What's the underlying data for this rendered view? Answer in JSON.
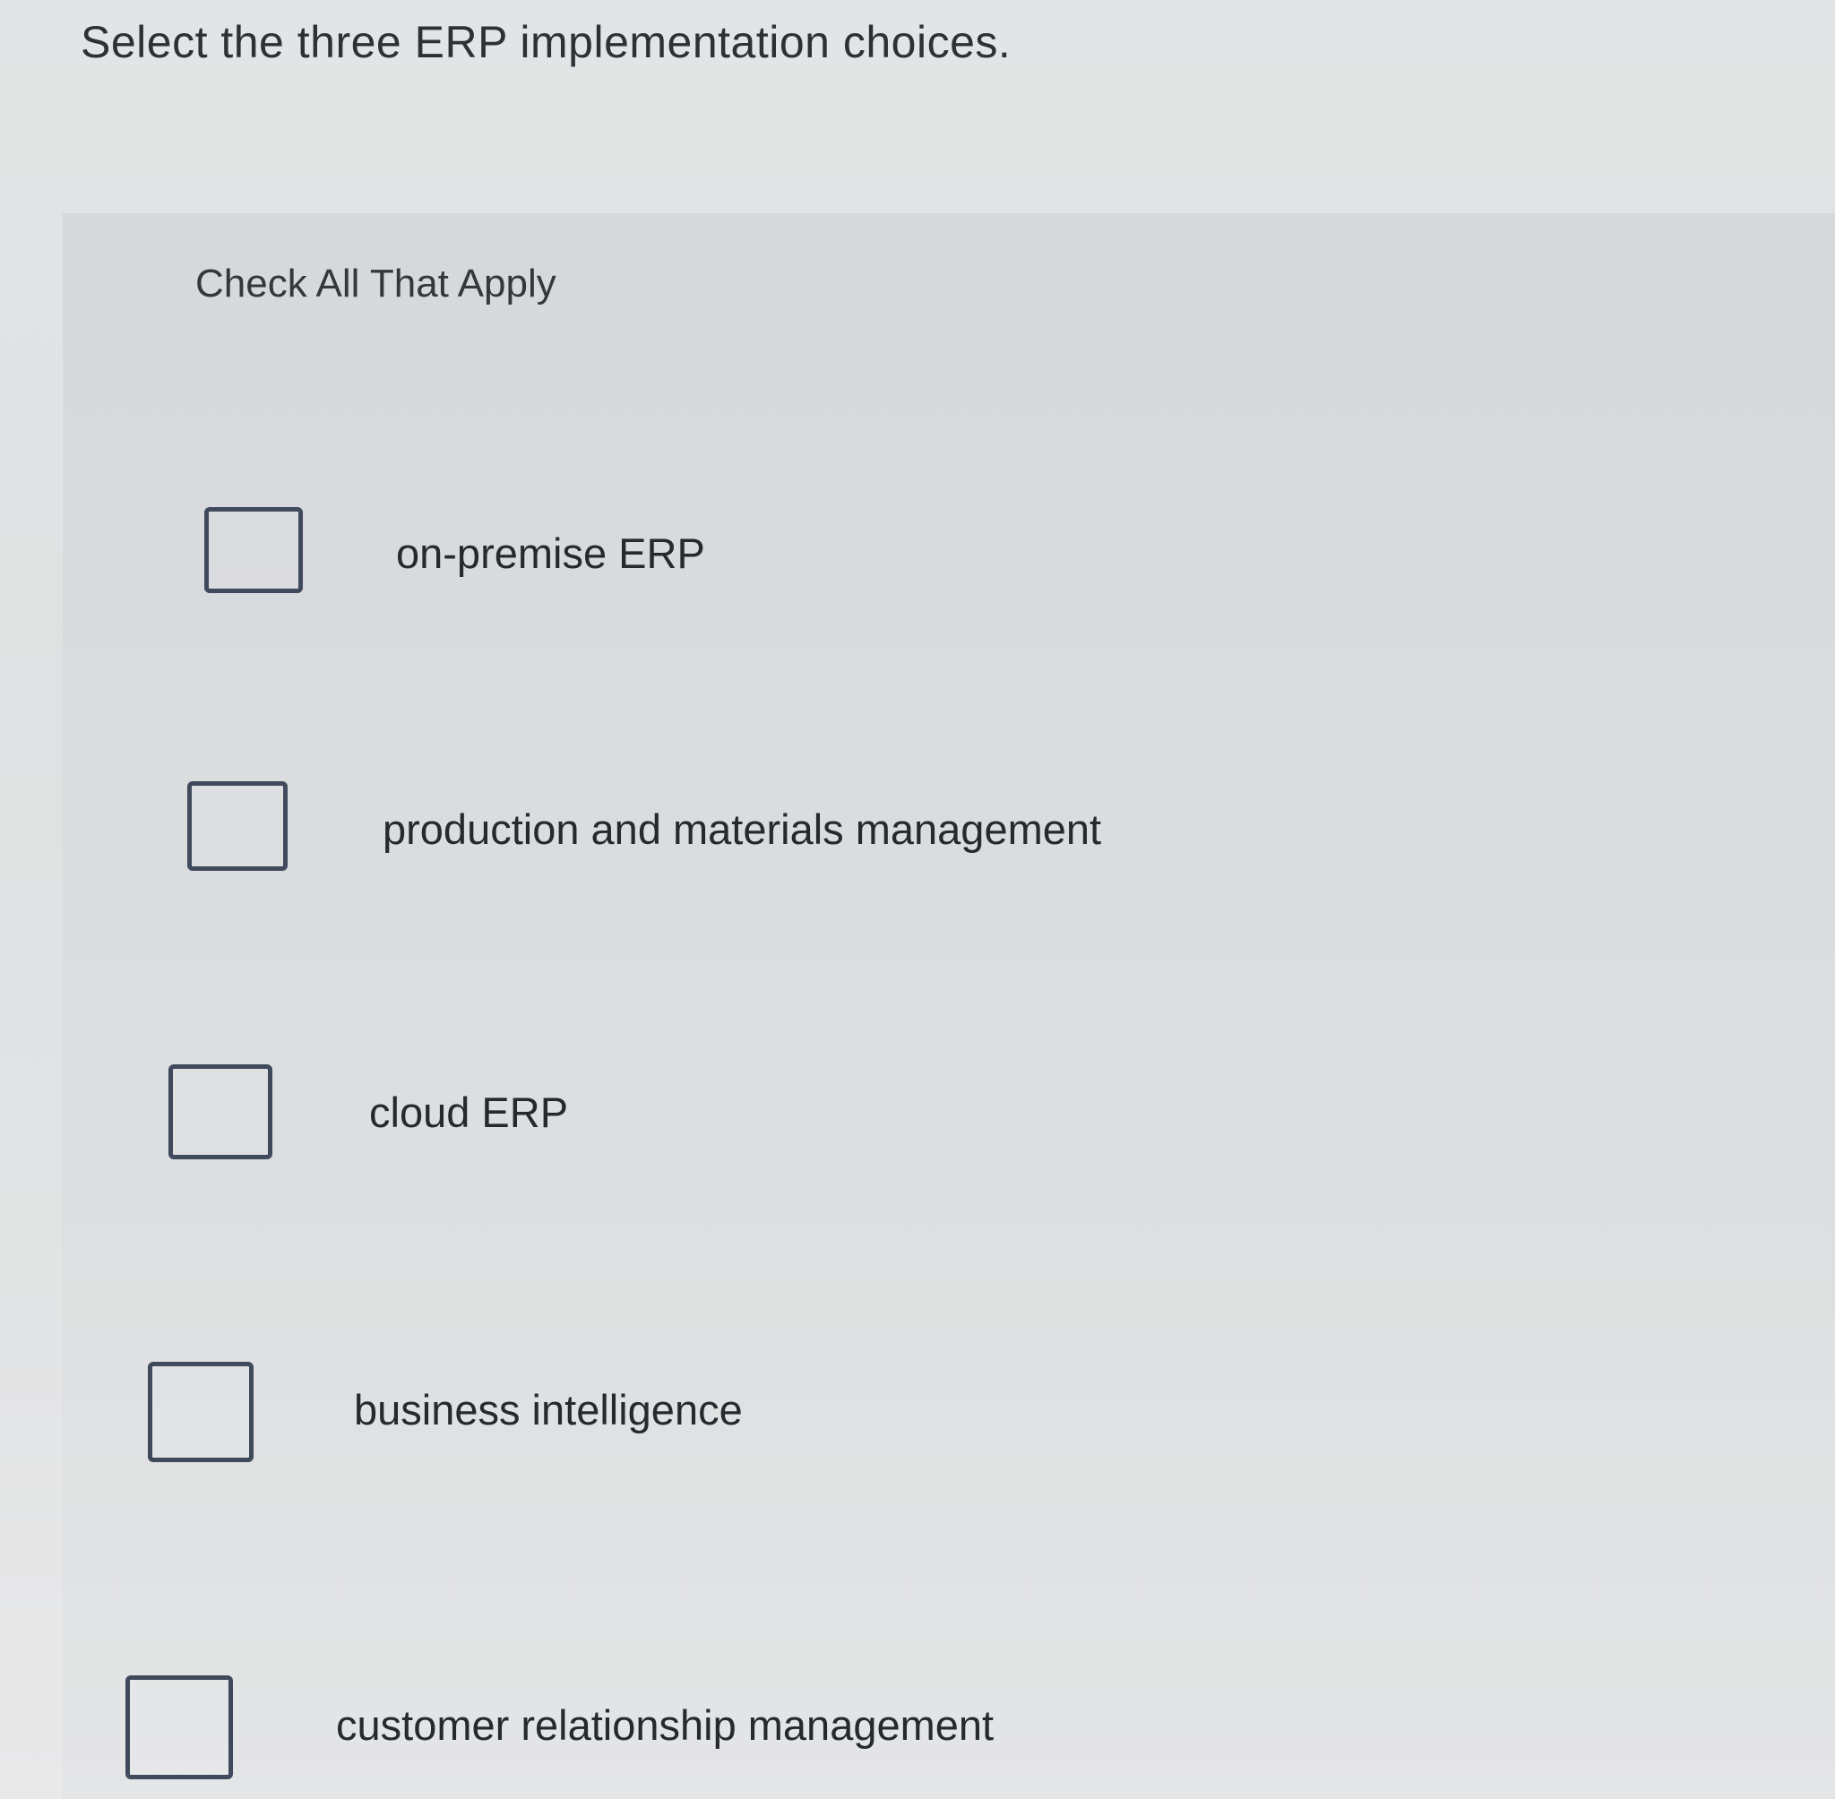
{
  "question": {
    "text": "Select the three ERP implementation choices."
  },
  "instruction": {
    "text": "Check All That Apply"
  },
  "options": [
    {
      "label": "on-premise ERP",
      "checked": false
    },
    {
      "label": "production and materials management",
      "checked": false
    },
    {
      "label": "cloud ERP",
      "checked": false
    },
    {
      "label": "business intelligence",
      "checked": false
    },
    {
      "label": "customer relationship management",
      "checked": false
    }
  ]
}
